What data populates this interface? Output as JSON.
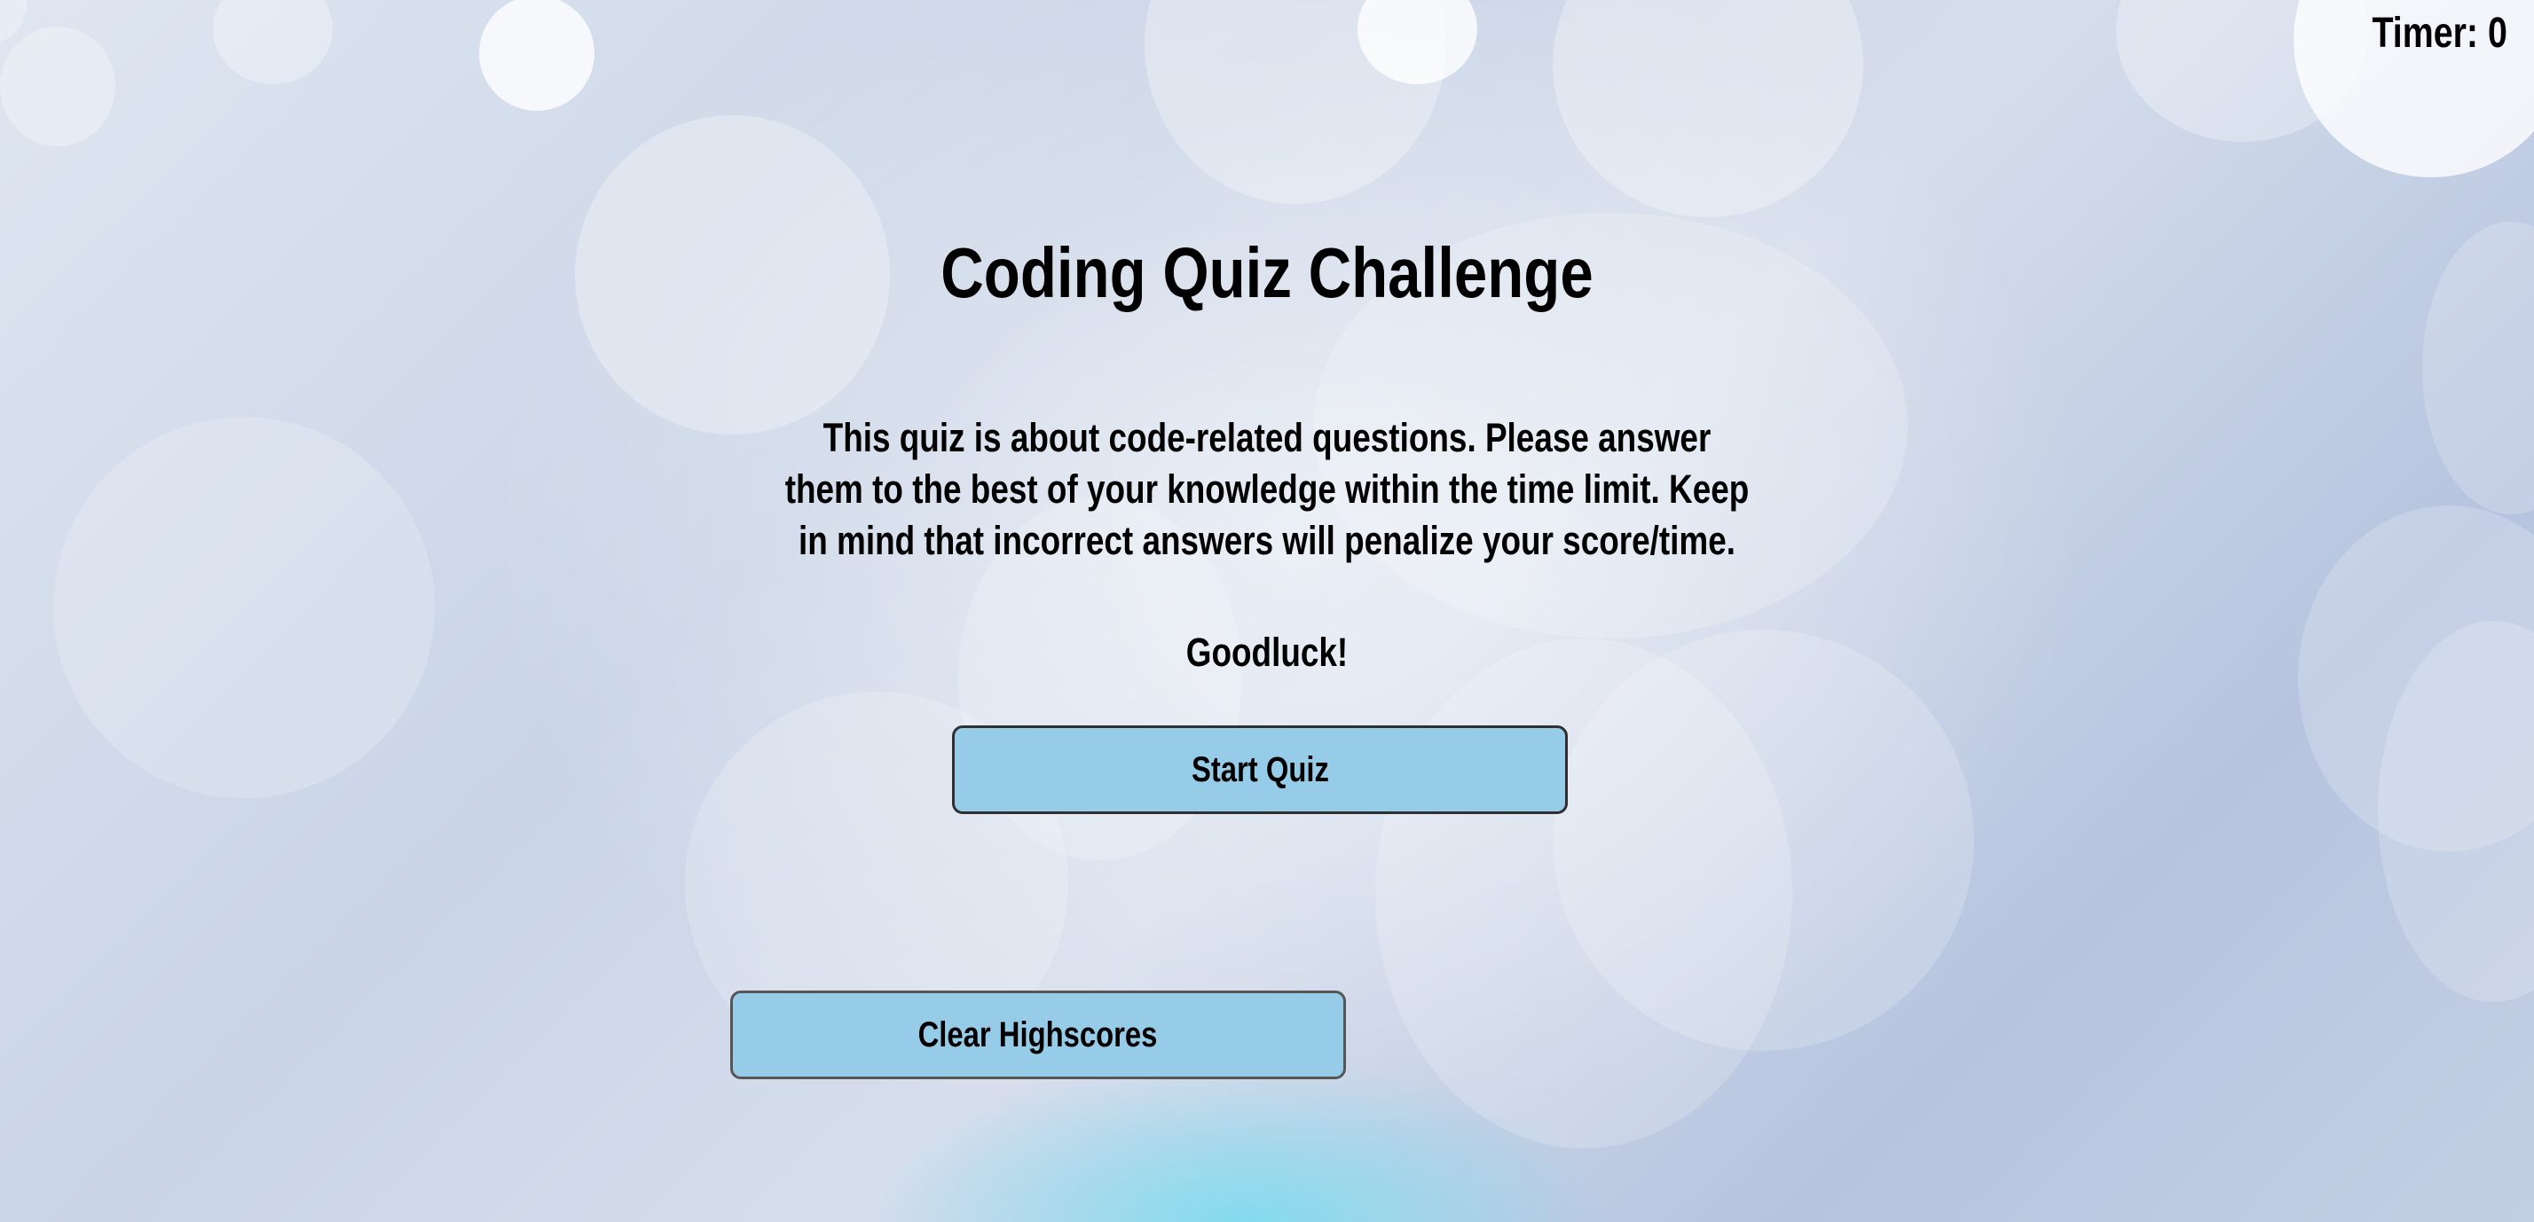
{
  "header": {
    "timer_label": "Timer: 0"
  },
  "main": {
    "title": "Coding Quiz Challenge",
    "description": "This quiz is about code-related questions. Please answer them to the best of your knowledge within the time limit. Keep in mind that incorrect answers will penalize your score/time.",
    "goodluck": "Goodluck!",
    "start_button_label": "Start Quiz",
    "clear_button_label": "Clear Highscores"
  },
  "colors": {
    "button_background": "#96cce8",
    "button_border": "#2f2f2f",
    "text": "#000000",
    "background_base": "#ccd6e8"
  }
}
